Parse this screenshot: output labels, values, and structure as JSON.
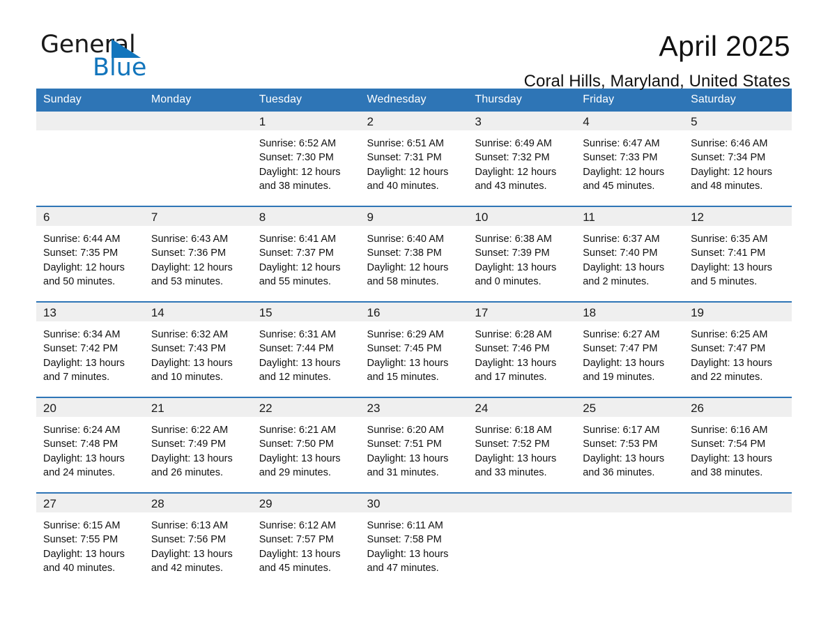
{
  "brand": {
    "name_top": "General",
    "name_bottom": "Blue",
    "accent_color": "#1275bc"
  },
  "header": {
    "month_title": "April 2025",
    "location": "Coral Hills, Maryland, United States"
  },
  "theme": {
    "header_blue": "#2e75b6",
    "daynum_band": "#efefef",
    "text": "#111111"
  },
  "calendar": {
    "weekday_headers": [
      "Sunday",
      "Monday",
      "Tuesday",
      "Wednesday",
      "Thursday",
      "Friday",
      "Saturday"
    ],
    "weeks": [
      [
        {
          "day": "",
          "lines": []
        },
        {
          "day": "",
          "lines": []
        },
        {
          "day": "1",
          "lines": [
            "Sunrise: 6:52 AM",
            "Sunset: 7:30 PM",
            "Daylight: 12 hours",
            "and 38 minutes."
          ]
        },
        {
          "day": "2",
          "lines": [
            "Sunrise: 6:51 AM",
            "Sunset: 7:31 PM",
            "Daylight: 12 hours",
            "and 40 minutes."
          ]
        },
        {
          "day": "3",
          "lines": [
            "Sunrise: 6:49 AM",
            "Sunset: 7:32 PM",
            "Daylight: 12 hours",
            "and 43 minutes."
          ]
        },
        {
          "day": "4",
          "lines": [
            "Sunrise: 6:47 AM",
            "Sunset: 7:33 PM",
            "Daylight: 12 hours",
            "and 45 minutes."
          ]
        },
        {
          "day": "5",
          "lines": [
            "Sunrise: 6:46 AM",
            "Sunset: 7:34 PM",
            "Daylight: 12 hours",
            "and 48 minutes."
          ]
        }
      ],
      [
        {
          "day": "6",
          "lines": [
            "Sunrise: 6:44 AM",
            "Sunset: 7:35 PM",
            "Daylight: 12 hours",
            "and 50 minutes."
          ]
        },
        {
          "day": "7",
          "lines": [
            "Sunrise: 6:43 AM",
            "Sunset: 7:36 PM",
            "Daylight: 12 hours",
            "and 53 minutes."
          ]
        },
        {
          "day": "8",
          "lines": [
            "Sunrise: 6:41 AM",
            "Sunset: 7:37 PM",
            "Daylight: 12 hours",
            "and 55 minutes."
          ]
        },
        {
          "day": "9",
          "lines": [
            "Sunrise: 6:40 AM",
            "Sunset: 7:38 PM",
            "Daylight: 12 hours",
            "and 58 minutes."
          ]
        },
        {
          "day": "10",
          "lines": [
            "Sunrise: 6:38 AM",
            "Sunset: 7:39 PM",
            "Daylight: 13 hours",
            "and 0 minutes."
          ]
        },
        {
          "day": "11",
          "lines": [
            "Sunrise: 6:37 AM",
            "Sunset: 7:40 PM",
            "Daylight: 13 hours",
            "and 2 minutes."
          ]
        },
        {
          "day": "12",
          "lines": [
            "Sunrise: 6:35 AM",
            "Sunset: 7:41 PM",
            "Daylight: 13 hours",
            "and 5 minutes."
          ]
        }
      ],
      [
        {
          "day": "13",
          "lines": [
            "Sunrise: 6:34 AM",
            "Sunset: 7:42 PM",
            "Daylight: 13 hours",
            "and 7 minutes."
          ]
        },
        {
          "day": "14",
          "lines": [
            "Sunrise: 6:32 AM",
            "Sunset: 7:43 PM",
            "Daylight: 13 hours",
            "and 10 minutes."
          ]
        },
        {
          "day": "15",
          "lines": [
            "Sunrise: 6:31 AM",
            "Sunset: 7:44 PM",
            "Daylight: 13 hours",
            "and 12 minutes."
          ]
        },
        {
          "day": "16",
          "lines": [
            "Sunrise: 6:29 AM",
            "Sunset: 7:45 PM",
            "Daylight: 13 hours",
            "and 15 minutes."
          ]
        },
        {
          "day": "17",
          "lines": [
            "Sunrise: 6:28 AM",
            "Sunset: 7:46 PM",
            "Daylight: 13 hours",
            "and 17 minutes."
          ]
        },
        {
          "day": "18",
          "lines": [
            "Sunrise: 6:27 AM",
            "Sunset: 7:47 PM",
            "Daylight: 13 hours",
            "and 19 minutes."
          ]
        },
        {
          "day": "19",
          "lines": [
            "Sunrise: 6:25 AM",
            "Sunset: 7:47 PM",
            "Daylight: 13 hours",
            "and 22 minutes."
          ]
        }
      ],
      [
        {
          "day": "20",
          "lines": [
            "Sunrise: 6:24 AM",
            "Sunset: 7:48 PM",
            "Daylight: 13 hours",
            "and 24 minutes."
          ]
        },
        {
          "day": "21",
          "lines": [
            "Sunrise: 6:22 AM",
            "Sunset: 7:49 PM",
            "Daylight: 13 hours",
            "and 26 minutes."
          ]
        },
        {
          "day": "22",
          "lines": [
            "Sunrise: 6:21 AM",
            "Sunset: 7:50 PM",
            "Daylight: 13 hours",
            "and 29 minutes."
          ]
        },
        {
          "day": "23",
          "lines": [
            "Sunrise: 6:20 AM",
            "Sunset: 7:51 PM",
            "Daylight: 13 hours",
            "and 31 minutes."
          ]
        },
        {
          "day": "24",
          "lines": [
            "Sunrise: 6:18 AM",
            "Sunset: 7:52 PM",
            "Daylight: 13 hours",
            "and 33 minutes."
          ]
        },
        {
          "day": "25",
          "lines": [
            "Sunrise: 6:17 AM",
            "Sunset: 7:53 PM",
            "Daylight: 13 hours",
            "and 36 minutes."
          ]
        },
        {
          "day": "26",
          "lines": [
            "Sunrise: 6:16 AM",
            "Sunset: 7:54 PM",
            "Daylight: 13 hours",
            "and 38 minutes."
          ]
        }
      ],
      [
        {
          "day": "27",
          "lines": [
            "Sunrise: 6:15 AM",
            "Sunset: 7:55 PM",
            "Daylight: 13 hours",
            "and 40 minutes."
          ]
        },
        {
          "day": "28",
          "lines": [
            "Sunrise: 6:13 AM",
            "Sunset: 7:56 PM",
            "Daylight: 13 hours",
            "and 42 minutes."
          ]
        },
        {
          "day": "29",
          "lines": [
            "Sunrise: 6:12 AM",
            "Sunset: 7:57 PM",
            "Daylight: 13 hours",
            "and 45 minutes."
          ]
        },
        {
          "day": "30",
          "lines": [
            "Sunrise: 6:11 AM",
            "Sunset: 7:58 PM",
            "Daylight: 13 hours",
            "and 47 minutes."
          ]
        },
        {
          "day": "",
          "lines": []
        },
        {
          "day": "",
          "lines": []
        },
        {
          "day": "",
          "lines": []
        }
      ]
    ]
  }
}
